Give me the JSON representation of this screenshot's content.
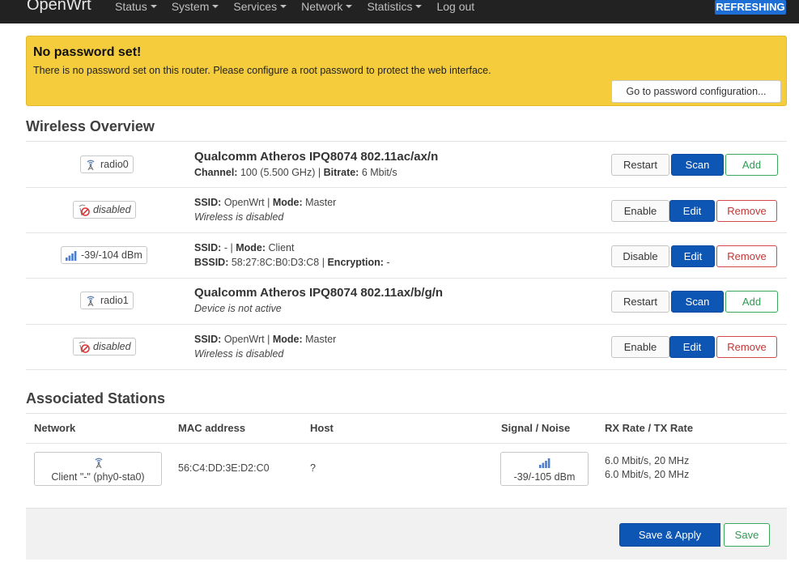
{
  "nav": {
    "brand": "OpenWrt",
    "menu": [
      "Status",
      "System",
      "Services",
      "Network",
      "Statistics"
    ],
    "logout": "Log out",
    "refreshing": "REFRESHING"
  },
  "alert": {
    "title": "No password set!",
    "text": "There is no password set on this router. Please configure a root password to protect the web interface.",
    "button": "Go to password configuration..."
  },
  "wireless": {
    "heading": "Wireless Overview",
    "labels": {
      "channel": "Channel:",
      "bitrate": "Bitrate:",
      "ssid": "SSID:",
      "mode": "Mode:",
      "bssid": "BSSID:",
      "encryption": "Encryption:"
    },
    "rows": [
      {
        "badge": "radio0",
        "title": "Qualcomm Atheros IPQ8074 802.11ac/ax/n",
        "channel": "100 (5.500 GHz)",
        "bitrate": "6 Mbit/s",
        "buttons": [
          "Restart",
          "Scan",
          "Add"
        ]
      },
      {
        "badge": "disabled",
        "ssid": "OpenWrt",
        "mode": "Master",
        "status": "Wireless is disabled",
        "buttons": [
          "Enable",
          "Edit",
          "Remove"
        ]
      },
      {
        "badge": "-39/-104 dBm",
        "ssid": "-",
        "mode": "Client",
        "bssid": "58:27:8C:B0:D3:C8",
        "encryption": "-",
        "buttons": [
          "Disable",
          "Edit",
          "Remove"
        ]
      },
      {
        "badge": "radio1",
        "title": "Qualcomm Atheros IPQ8074 802.11ax/b/g/n",
        "status": "Device is not active",
        "buttons": [
          "Restart",
          "Scan",
          "Add"
        ]
      },
      {
        "badge": "disabled",
        "ssid": "OpenWrt",
        "mode": "Master",
        "status": "Wireless is disabled",
        "buttons": [
          "Enable",
          "Edit",
          "Remove"
        ]
      }
    ]
  },
  "stations": {
    "heading": "Associated Stations",
    "columns": [
      "Network",
      "MAC address",
      "Host",
      "Signal / Noise",
      "RX Rate / TX Rate"
    ],
    "rows": [
      {
        "network": "Client \"-\" (phy0-sta0)",
        "mac": "56:C4:DD:3E:D2:C0",
        "host": "?",
        "signal": "-39/-105 dBm",
        "rx": "6.0 Mbit/s, 20 MHz",
        "tx": "6.0 Mbit/s, 20 MHz"
      }
    ]
  },
  "footer": {
    "save_apply": "Save & Apply",
    "save": "Save"
  },
  "colors": {
    "navbar": "#222222",
    "alert": "#f5cd3c",
    "primary": "#0d56b4",
    "positive": "#39a85b",
    "negative": "#d44848",
    "refreshing": "#1d6fd6"
  }
}
